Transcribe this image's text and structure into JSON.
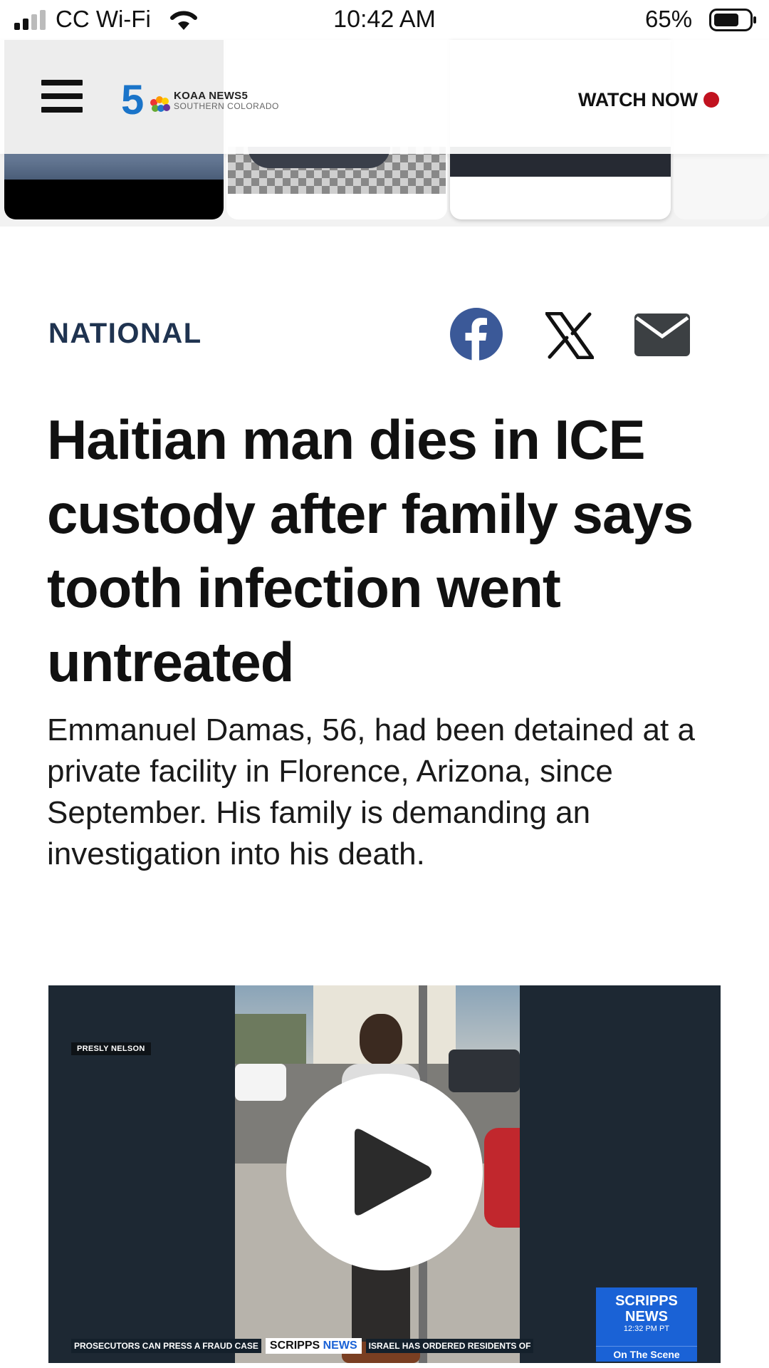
{
  "status_bar": {
    "carrier": "CC Wi-Fi",
    "time": "10:42 AM",
    "battery_percent": "65%"
  },
  "header": {
    "logo_name": "KOAA NEWS5",
    "logo_subtitle": "SOUTHERN COLORADO",
    "watch_now_label": "WATCH NOW"
  },
  "article": {
    "category": "NATIONAL",
    "headline": "Haitian man dies in ICE custody after family says tooth infection went untreated",
    "dek": "Emmanuel Damas, 56, had been detained at a private facility in Florence, Arizona, since September. His family is demanding an investigation into his death."
  },
  "share": {
    "icons": [
      "facebook-icon",
      "x-icon",
      "mail-icon"
    ]
  },
  "video": {
    "name_tag": "PRESLY NELSON",
    "ticker_left": "PROSECUTORS CAN PRESS A FRAUD CASE",
    "ticker_brand_1": "SCRIPPS",
    "ticker_brand_2": "NEWS",
    "ticker_right": "ISRAEL HAS ORDERED RESIDENTS OF",
    "badge_brand": "SCRIPPS NEWS",
    "badge_time": "12:32 PM PT",
    "badge_label": "On The Scene"
  },
  "colors": {
    "category": "#1f3350",
    "live_dot": "#c1121f",
    "facebook": "#3b5998",
    "scripps_blue": "#1a62d6"
  }
}
